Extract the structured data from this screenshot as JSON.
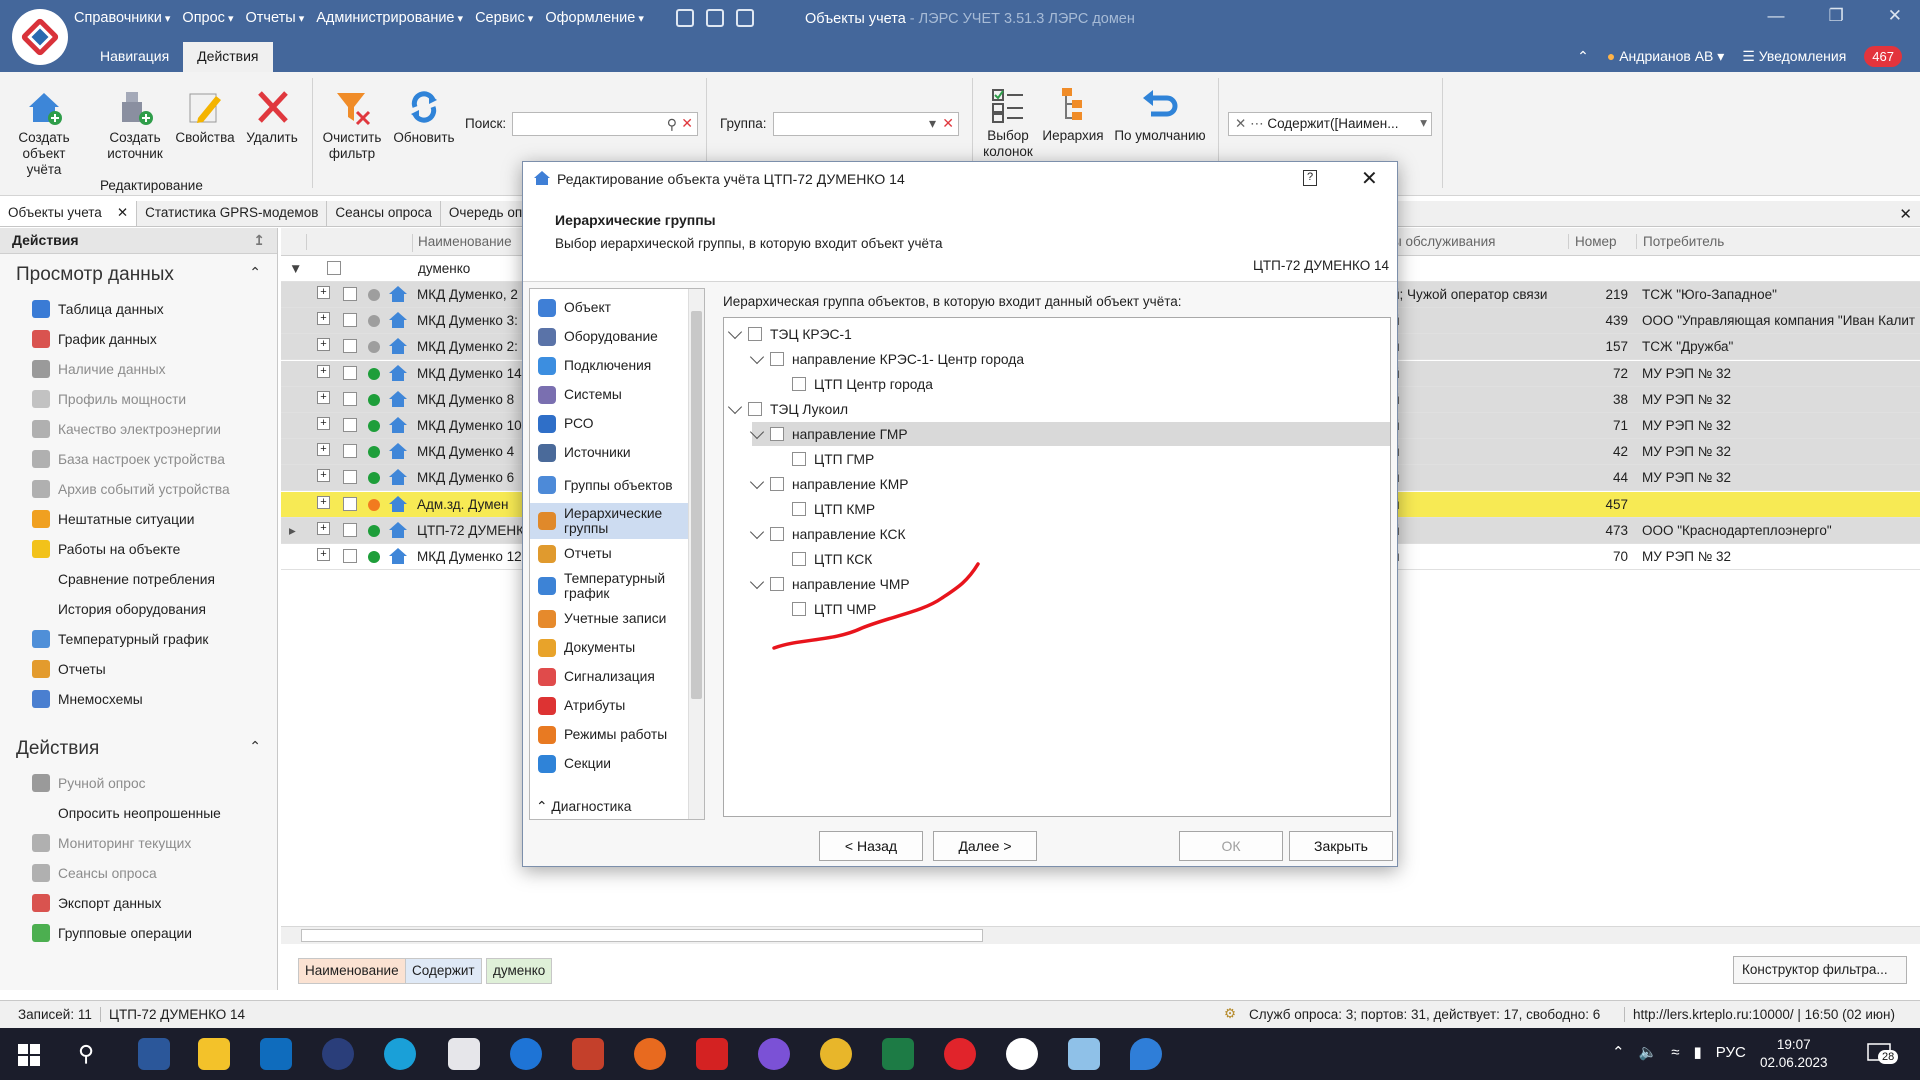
{
  "app": {
    "menu": [
      "Справочники",
      "Опрос",
      "Отчеты",
      "Администрирование",
      "Сервис",
      "Оформление"
    ],
    "title_main": "Объекты учета",
    "title_dim": " - ЛЭРС УЧЕТ 3.51.3 ЛЭРС домен",
    "tabs": [
      "Навигация",
      "Действия"
    ],
    "user": "Андрианов АВ",
    "notifications_label": "Уведомления",
    "notifications_count": "467"
  },
  "ribbon": {
    "create_object": "Создать объект учёта",
    "create_source": "Создать источник",
    "properties": "Свойства",
    "delete": "Удалить",
    "group_editing": "Редактирование",
    "clear_filter": "Очистить фильтр",
    "refresh": "Обновить",
    "search_label": "Поиск:",
    "search_value": "",
    "group_label": "Группа:",
    "group_value": "",
    "choose_columns": "Выбор колонок",
    "hierarchy": "Иерархия",
    "default": "По умолчанию",
    "filter_value": "Содержит([Наимен..."
  },
  "doc_tabs": [
    "Объекты учета",
    "Статистика GPRS-модемов",
    "Сеансы опроса",
    "Очередь оп"
  ],
  "left_pane": {
    "header": "Действия",
    "section_view": "Просмотр данных",
    "view_items": [
      {
        "label": "Таблица данных",
        "dim": false,
        "icon": "table-icon",
        "color": "#3a7bd5"
      },
      {
        "label": "График данных",
        "dim": false,
        "icon": "chart-icon",
        "color": "#d9534f"
      },
      {
        "label": "Наличие данных",
        "dim": true,
        "icon": "data-availability-icon",
        "color": "#9a9a9a"
      },
      {
        "label": "Профиль мощности",
        "dim": true,
        "icon": "power-profile-icon",
        "color": "#c2c2c2"
      },
      {
        "label": "Качество электроэнергии",
        "dim": true,
        "icon": "power-quality-icon",
        "color": "#b0b0b0"
      },
      {
        "label": "База настроек устройства",
        "dim": true,
        "icon": "device-settings-icon",
        "color": "#b0b0b0"
      },
      {
        "label": "Архив событий устройства",
        "dim": true,
        "icon": "event-archive-icon",
        "color": "#b0b0b0"
      },
      {
        "label": "Нештатные ситуации",
        "dim": false,
        "icon": "warning-icon",
        "color": "#f0a020"
      },
      {
        "label": "Работы на объекте",
        "dim": false,
        "icon": "works-icon",
        "color": "#f2c21a"
      },
      {
        "label": "Сравнение потребления",
        "dim": false,
        "icon": "",
        "color": ""
      },
      {
        "label": "История оборудования",
        "dim": false,
        "icon": "",
        "color": ""
      },
      {
        "label": "Температурный график",
        "dim": false,
        "icon": "temperature-chart-icon",
        "color": "#4f8fd8"
      },
      {
        "label": "Отчеты",
        "dim": false,
        "icon": "reports-icon",
        "color": "#e39b2d"
      },
      {
        "label": "Мнемосхемы",
        "dim": false,
        "icon": "mnemonic-icon",
        "color": "#4a7fd0"
      }
    ],
    "section_actions": "Действия",
    "action_items": [
      {
        "label": "Ручной опрос",
        "dim": true,
        "icon": "play-icon",
        "color": "#9a9a9a"
      },
      {
        "label": "Опросить неопрошенные",
        "dim": false,
        "icon": "",
        "color": ""
      },
      {
        "label": "Мониторинг текущих",
        "dim": true,
        "icon": "monitor-icon",
        "color": "#b0b0b0"
      },
      {
        "label": "Сеансы опроса",
        "dim": true,
        "icon": "sessions-icon",
        "color": "#b0b0b0"
      },
      {
        "label": "Экспорт данных",
        "dim": false,
        "icon": "export-icon",
        "color": "#d9534f"
      },
      {
        "label": "Групповые операции",
        "dim": false,
        "icon": "check-icon",
        "color": "#4caf50"
      }
    ]
  },
  "grid": {
    "col_name": "Наименование",
    "col_service": "ы обслуживания",
    "col_number": "Номер",
    "col_consumer": "Потребитель",
    "filter_text": "думенко",
    "rows": [
      {
        "name": "МКД Думенко, 2",
        "service": "й; Чужой оператор связи",
        "number": "219",
        "consumer": "ТСЖ \"Юго-Западное\"",
        "status": "#9e9e9e",
        "shade": "#dcdcdc"
      },
      {
        "name": "МКД Думенко 3:",
        "service": "й",
        "number": "439",
        "consumer": "ООО \"Управляющая компания \"Иван Калит",
        "status": "#9e9e9e",
        "shade": "#dcdcdc"
      },
      {
        "name": "МКД Думенко 2:",
        "service": "й",
        "number": "157",
        "consumer": "ТСЖ \"Дружба\"",
        "status": "#9e9e9e",
        "shade": "#dcdcdc"
      },
      {
        "name": "МКД Думенко 14",
        "service": "й",
        "number": "72",
        "consumer": "МУ РЭП № 32",
        "status": "#1e9e3a",
        "shade": "#dcdcdc"
      },
      {
        "name": "МКД Думенко 8",
        "service": "й",
        "number": "38",
        "consumer": "МУ РЭП № 32",
        "status": "#1e9e3a",
        "shade": "#dcdcdc"
      },
      {
        "name": "МКД Думенко 10",
        "service": "й",
        "number": "71",
        "consumer": "МУ РЭП № 32",
        "status": "#1e9e3a",
        "shade": "#dcdcdc"
      },
      {
        "name": "МКД Думенко 4",
        "service": "й",
        "number": "42",
        "consumer": "МУ РЭП № 32",
        "status": "#1e9e3a",
        "shade": "#dcdcdc"
      },
      {
        "name": "МКД Думенко 6",
        "service": "й",
        "number": "44",
        "consumer": "МУ РЭП № 32",
        "status": "#1e9e3a",
        "shade": "#dcdcdc"
      },
      {
        "name": "Адм.зд. Думен",
        "service": "й",
        "number": "457",
        "consumer": "",
        "status": "#f27b1f",
        "shade": "#f7ea54"
      },
      {
        "name": "ЦТП-72 ДУМЕНК",
        "service": "й",
        "number": "473",
        "consumer": "ООО \"Краснодартеплоэнерго\"",
        "status": "#1e9e3a",
        "shade": "#dcdcdc"
      },
      {
        "name": "МКД Думенко 12",
        "service": "й",
        "number": "70",
        "consumer": "МУ РЭП № 32",
        "status": "#1e9e3a",
        "shade": "#ffffff"
      }
    ]
  },
  "filter_chips": [
    "Наименование",
    "Содержит",
    "думенко"
  ],
  "filter_builder": "Конструктор фильтра...",
  "status": {
    "records": "Записей: 11",
    "current": "ЦТП-72 ДУМЕНКО 14",
    "services": "Служб опроса: 3; портов: 31, действует: 17, свободно: 6",
    "server": "http://lers.krteplo.ru:10000/ | 16:50 (02 июн)"
  },
  "dialog": {
    "title": "Редактирование объекта учёта ЦТП-72 ДУМЕНКО 14",
    "heading": "Иерархические группы",
    "subheading": "Выбор иерархической группы, в которую входит объект учёта",
    "object_name": "ЦТП-72 ДУМЕНКО 14",
    "tree_caption": "Иерархическая группа объектов, в которую входит данный объект учёта:",
    "nav": [
      {
        "label": "Объект",
        "icon": "house-icon",
        "color": "#3f7fd6"
      },
      {
        "label": "Оборудование",
        "icon": "equipment-icon",
        "color": "#5a73a8"
      },
      {
        "label": "Подключения",
        "icon": "globe-icon",
        "color": "#3c8ee0"
      },
      {
        "label": "Системы",
        "icon": "systems-icon",
        "color": "#7a6fb0"
      },
      {
        "label": "РСО",
        "icon": "rso-icon",
        "color": "#2f6fc8"
      },
      {
        "label": "Источники",
        "icon": "sources-icon",
        "color": "#4a6a9a"
      },
      {
        "label": "Группы объектов",
        "icon": "object-groups-icon",
        "color": "#4d8ad8"
      },
      {
        "label": "Иерархические группы",
        "icon": "hierarchy-icon",
        "color": "#e0892a"
      },
      {
        "label": "Отчеты",
        "icon": "report-icon",
        "color": "#e09a2e"
      },
      {
        "label": "Температурный график",
        "icon": "temperature-icon",
        "color": "#3d83d6"
      },
      {
        "label": "Учетные записи",
        "icon": "user-icon",
        "color": "#e68a2c"
      },
      {
        "label": "Документы",
        "icon": "folder-icon",
        "color": "#e8a32a"
      },
      {
        "label": "Сигнализация",
        "icon": "alarm-icon",
        "color": "#e04b4b"
      },
      {
        "label": "Атрибуты",
        "icon": "attributes-icon",
        "color": "#d33"
      },
      {
        "label": "Режимы работы",
        "icon": "calendar-icon",
        "color": "#e87a22"
      },
      {
        "label": "Секции",
        "icon": "sections-icon",
        "color": "#2f83d8"
      }
    ],
    "nav_group": "Диагностика",
    "tree": [
      {
        "label": "ТЭЦ КРЭС-1",
        "level": 0,
        "chev": true,
        "hl": false
      },
      {
        "label": "направление КРЭС-1- Центр города",
        "level": 1,
        "chev": true,
        "hl": false
      },
      {
        "label": "ЦТП Центр города",
        "level": 2,
        "chev": false,
        "hl": false
      },
      {
        "label": "ТЭЦ Лукоил",
        "level": 0,
        "chev": true,
        "hl": false
      },
      {
        "label": "направление ГМР",
        "level": 1,
        "chev": true,
        "hl": true
      },
      {
        "label": "ЦТП ГМР",
        "level": 2,
        "chev": false,
        "hl": false
      },
      {
        "label": "направление КМР",
        "level": 1,
        "chev": true,
        "hl": false
      },
      {
        "label": "ЦТП КМР",
        "level": 2,
        "chev": false,
        "hl": false
      },
      {
        "label": "направление КСК",
        "level": 1,
        "chev": true,
        "hl": false
      },
      {
        "label": "ЦТП КСК",
        "level": 2,
        "chev": false,
        "hl": false
      },
      {
        "label": "направление ЧМР",
        "level": 1,
        "chev": true,
        "hl": false
      },
      {
        "label": "ЦТП ЧМР",
        "level": 2,
        "chev": false,
        "hl": false
      }
    ],
    "btn_back": "< Назад",
    "btn_next": "Далее >",
    "btn_ok": "ОК",
    "btn_close": "Закрыть"
  },
  "taskbar": {
    "lang": "РУС",
    "time": "19:07",
    "date": "02.06.2023",
    "notif_count": "28"
  }
}
